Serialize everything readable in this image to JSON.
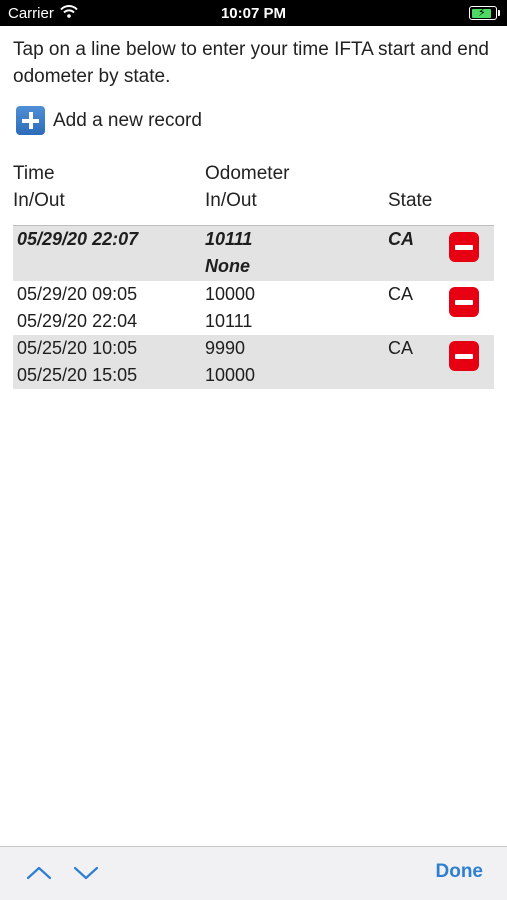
{
  "status_bar": {
    "carrier": "Carrier",
    "time": "10:07 PM"
  },
  "instructions": "Tap on a line below to enter your time IFTA start and end odometer by state.",
  "add_record": {
    "label": "Add a new record",
    "icon": "plus-icon"
  },
  "headers": {
    "time_line1": "Time",
    "time_line2": "In/Out",
    "odometer_line1": "Odometer",
    "odometer_line2": "In/Out",
    "state": "State"
  },
  "rows": [
    {
      "time_in": "05/29/20 22:07",
      "time_out": "",
      "odo_in": "10111",
      "odo_out": "None",
      "state": "CA"
    },
    {
      "time_in": "05/29/20 09:05",
      "time_out": "05/29/20 22:04",
      "odo_in": "10000",
      "odo_out": "10111",
      "state": "CA"
    },
    {
      "time_in": "05/25/20 10:05",
      "time_out": "05/25/20 15:05",
      "odo_in": "9990",
      "odo_out": "10000",
      "state": "CA"
    }
  ],
  "toolbar": {
    "done_label": "Done",
    "up_icon": "chevron-up-icon",
    "down_icon": "chevron-down-icon"
  },
  "colors": {
    "accent": "#2f7fd0",
    "delete": "#e60012",
    "row_shade": "#e3e3e3"
  }
}
